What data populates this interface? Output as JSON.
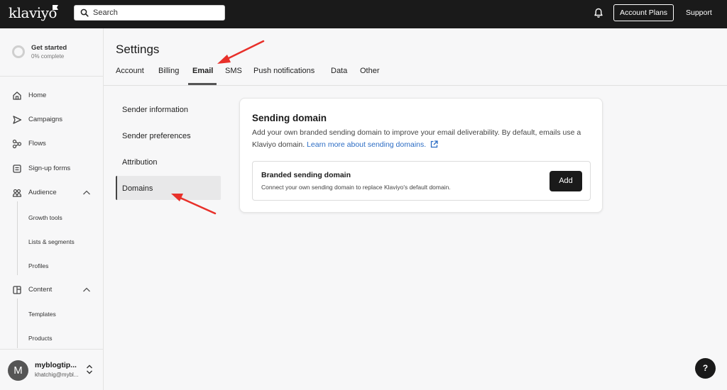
{
  "brand": {
    "logo_text": "klaviyo",
    "accent": "#1a1a1a",
    "link_color": "#2b6cc4",
    "annotation_color": "#e8302a"
  },
  "topbar": {
    "search_placeholder": "Search",
    "account_plans_label": "Account Plans",
    "support_label": "Support"
  },
  "sidebar": {
    "get_started": {
      "title": "Get started",
      "progress": "0% complete"
    },
    "items": [
      {
        "label": "Home",
        "icon": "home-icon"
      },
      {
        "label": "Campaigns",
        "icon": "send-icon"
      },
      {
        "label": "Flows",
        "icon": "flows-icon"
      },
      {
        "label": "Sign-up forms",
        "icon": "form-icon"
      },
      {
        "label": "Audience",
        "icon": "people-icon"
      },
      {
        "label": "Content",
        "icon": "content-icon"
      }
    ],
    "audience_sub": [
      "Growth tools",
      "Lists & segments",
      "Profiles"
    ],
    "content_sub": [
      "Templates",
      "Products"
    ],
    "user": {
      "avatar_letter": "M",
      "name": "myblogtip...",
      "email": "khatchig@mybl..."
    }
  },
  "main": {
    "title": "Settings",
    "tabs": [
      "Account",
      "Billing",
      "Email",
      "SMS",
      "Push notifications",
      "Data",
      "Other"
    ],
    "active_tab": "Email",
    "subnav": [
      "Sender information",
      "Sender preferences",
      "Attribution",
      "Domains"
    ],
    "active_subnav": "Domains",
    "card": {
      "title": "Sending domain",
      "description": "Add your own branded sending domain to improve your email deliverability. By default, emails use a Klaviyo domain.",
      "link_text": "Learn more about sending domains.",
      "inner_title": "Branded sending domain",
      "inner_subtitle": "Connect your own sending domain to replace Klaviyo's default domain.",
      "add_label": "Add"
    }
  },
  "help_label": "?"
}
